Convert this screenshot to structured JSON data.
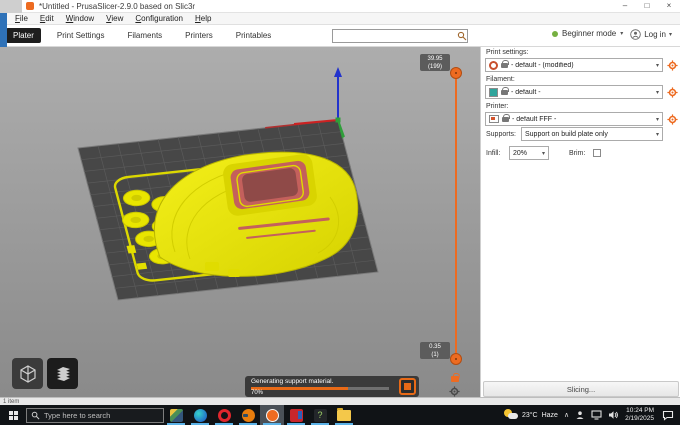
{
  "window": {
    "title": "*Untitled - PrusaSlicer-2.9.0 based on Slic3r",
    "controls": {
      "minimize": "–",
      "maximize": "□",
      "close": "×"
    }
  },
  "menu": {
    "items": [
      "File",
      "Edit",
      "Window",
      "View",
      "Configuration",
      "Help"
    ]
  },
  "tabs": {
    "items": [
      "Plater",
      "Print Settings",
      "Filaments",
      "Printers",
      "Printables"
    ],
    "active": "Plater"
  },
  "topbar": {
    "mode_label": "Beginner mode",
    "login_label": "Log in"
  },
  "glyphs": {
    "chevron_down": "▾",
    "question": "?"
  },
  "panel": {
    "print_settings_label": "Print settings:",
    "print_settings_value": "- default - (modified)",
    "filament_label": "Filament:",
    "filament_value": "- default -",
    "printer_label": "Printer:",
    "printer_value": "- default FFF -",
    "supports_label": "Supports:",
    "supports_value": "Support on build plate only",
    "infill_label": "Infill:",
    "infill_value": "20%",
    "brim_label": "Brim:",
    "brim_checked": false,
    "slice_button": "Slicing..."
  },
  "viewport": {
    "slider": {
      "top_value": "39.95",
      "top_layer": "(199)",
      "bottom_value": "0.35",
      "bottom_layer": "(1)"
    },
    "progress": {
      "message": "Generating support material.",
      "percent": 70,
      "percent_label": "70%"
    },
    "status": "1 item"
  },
  "taskbar": {
    "search_placeholder": "Type here to search",
    "weather_temp": "23°C",
    "weather_condition": "Haze",
    "time": "10:24 PM",
    "date": "2/19/2025"
  },
  "colors": {
    "accent_orange": "#ED6B21",
    "filament_swatch": "#2EA49B",
    "mode_dot": "#76B041",
    "progress_fill": "#E86A17",
    "model_yellow": "#F2EE00",
    "overhang_red": "#C4605C"
  }
}
